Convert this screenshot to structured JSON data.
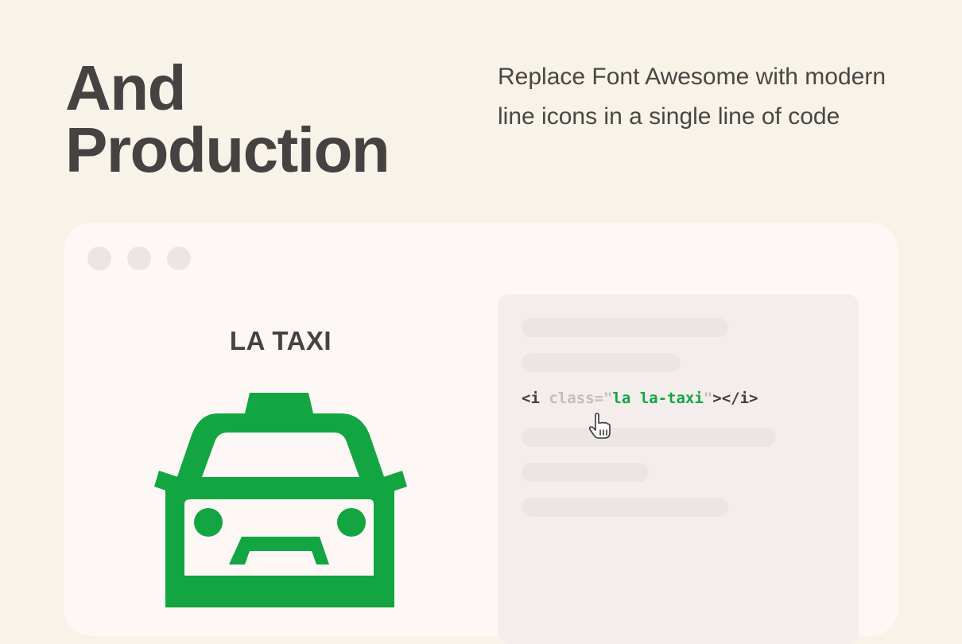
{
  "hero": {
    "title_line1": "And",
    "title_line2": "Production",
    "description": "Replace Font Awesome with modern line icons in a single line of code"
  },
  "preview": {
    "icon_label": "LA TAXI",
    "icon_name": "taxi-icon",
    "icon_color": "#13a542"
  },
  "code": {
    "open_tag": "<i ",
    "attr_name": "class=",
    "quote_open": "\"",
    "attr_value": "la la-taxi",
    "quote_close": "\"",
    "close_tag": "></i>"
  },
  "cursor": {
    "icon_name": "hand-pointer-icon"
  },
  "colors": {
    "background": "#f8f3e9",
    "window": "#fdf8f5",
    "code_panel": "#f3eeec",
    "accent_green": "#13a542",
    "text_dark": "#454241"
  }
}
